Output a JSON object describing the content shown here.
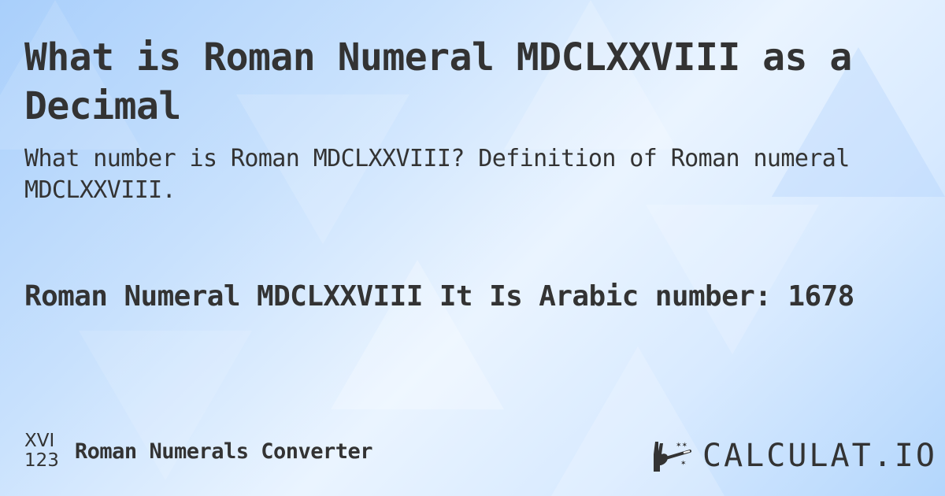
{
  "page": {
    "title": "What is Roman Numeral MDCLXXVIII as a Decimal",
    "subtitle": "What number is Roman MDCLXXVIII? Definition of Roman numeral MDCLXXVIII.",
    "answer": "Roman Numeral MDCLXXVIII It Is  Arabic number: 1678"
  },
  "footer": {
    "icon_top": "XVI",
    "icon_bottom": "123",
    "label": "Roman Numerals Converter",
    "brand": "CALCULAT.IO",
    "brand_icon": "magic-hand-wand-icon"
  },
  "colors": {
    "text": "#333333",
    "background_light": "#eaf4ff",
    "background_blue": "#a9cffb"
  }
}
